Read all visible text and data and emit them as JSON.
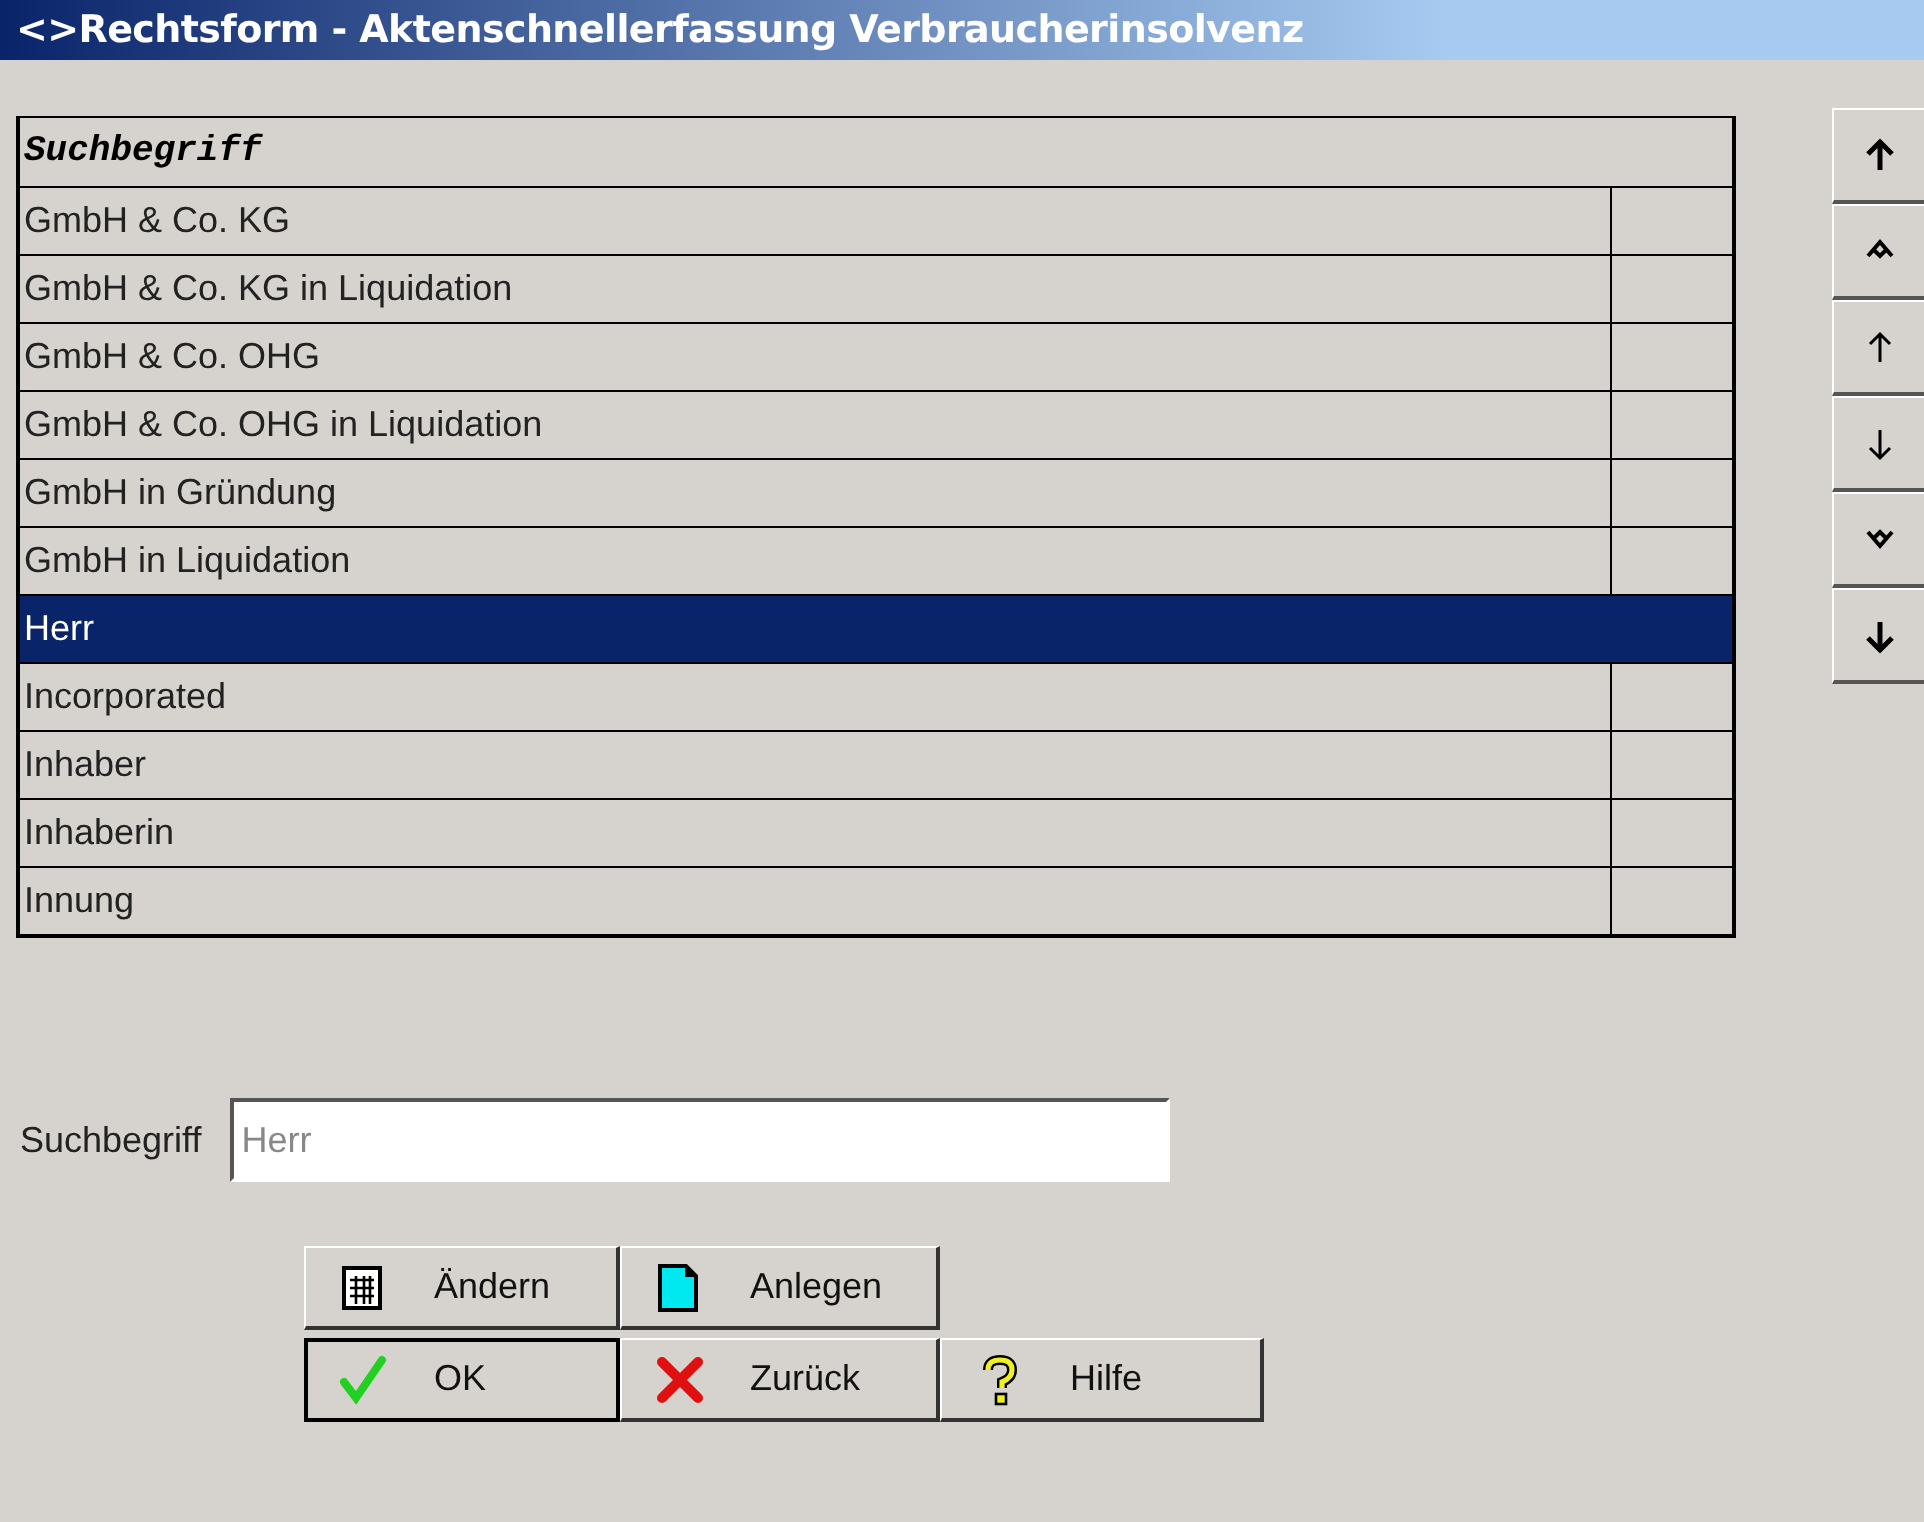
{
  "window": {
    "title": "<>Rechtsform - Aktenschnellerfassung Verbraucherinsolvenz"
  },
  "table": {
    "columns": [
      "Suchbegriff"
    ],
    "rows": [
      {
        "label": "GmbH & Co. KG",
        "selected": false
      },
      {
        "label": "GmbH & Co. KG in Liquidation",
        "selected": false
      },
      {
        "label": "GmbH & Co. OHG",
        "selected": false
      },
      {
        "label": "GmbH & Co. OHG in Liquidation",
        "selected": false
      },
      {
        "label": "GmbH in Gründung",
        "selected": false
      },
      {
        "label": "GmbH in Liquidation",
        "selected": false
      },
      {
        "label": "Herr",
        "selected": true
      },
      {
        "label": "Incorporated",
        "selected": false
      },
      {
        "label": "Inhaber",
        "selected": false
      },
      {
        "label": "Inhaberin",
        "selected": false
      },
      {
        "label": "Innung",
        "selected": false
      }
    ]
  },
  "nav_buttons": [
    {
      "kind": "first"
    },
    {
      "kind": "page-up"
    },
    {
      "kind": "up"
    },
    {
      "kind": "down"
    },
    {
      "kind": "page-down"
    },
    {
      "kind": "last"
    }
  ],
  "search": {
    "label": "Suchbegriff",
    "value": "Herr"
  },
  "buttons": [
    {
      "label": "Ändern",
      "kind": "edit",
      "default": false
    },
    {
      "label": "Anlegen",
      "kind": "new",
      "default": false
    },
    {
      "label": "OK",
      "kind": "ok",
      "default": true
    },
    {
      "label": "Zurück",
      "kind": "cancel",
      "default": false
    },
    {
      "label": "Hilfe",
      "kind": "help",
      "default": false
    }
  ]
}
